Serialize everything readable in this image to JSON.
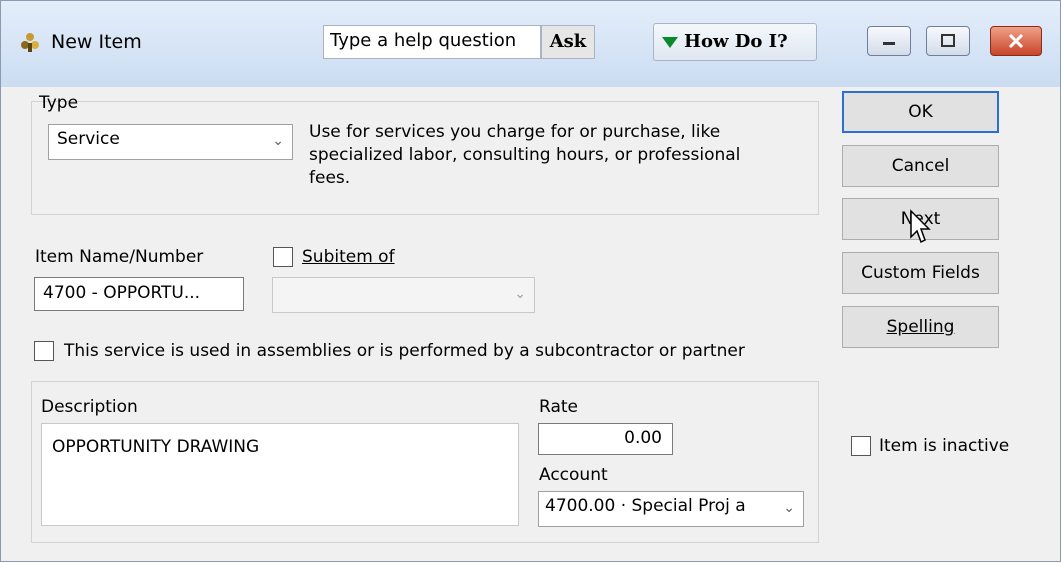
{
  "window": {
    "title": "New Item",
    "help_placeholder": "Type a help question",
    "ask_label": "Ask",
    "how_do_i_label": "How Do I?"
  },
  "type_section": {
    "label": "Type",
    "selected": "Service",
    "description": [
      "Use for services you charge for or purchase, like",
      "specialized labor, consulting hours, or professional",
      "fees."
    ]
  },
  "item": {
    "name_label": "Item Name/Number",
    "name_value": "4700 - OPPORTU...",
    "subitem_label": "Subitem of",
    "subitem_value": ""
  },
  "assemblies_checkbox_label": "This service is used in assemblies or is performed by a subcontractor or partner",
  "description": {
    "label": "Description",
    "value": "OPPORTUNITY DRAWING"
  },
  "rate": {
    "label": "Rate",
    "value": "0.00"
  },
  "account": {
    "label": "Account",
    "value": "4700.00 · Special Proj a"
  },
  "buttons": {
    "ok": "OK",
    "cancel": "Cancel",
    "next": "Next",
    "custom_fields": "Custom Fields",
    "spelling": "Spelling"
  },
  "inactive_label": "Item is inactive",
  "colors": {
    "default_button_border": "#2a6fd6",
    "how_do_i_arrow": "#0a8a2a",
    "close_button": "#c8442a"
  }
}
